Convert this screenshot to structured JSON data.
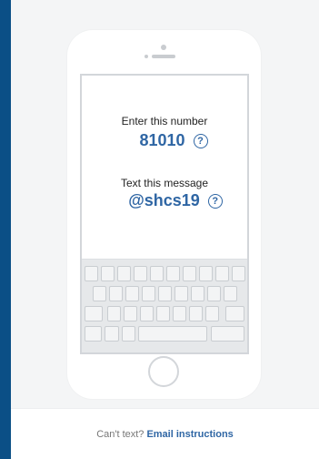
{
  "screen": {
    "number_label": "Enter this number",
    "number_value": "81010",
    "message_label": "Text this message",
    "message_value": "@shcs19",
    "help_glyph": "?"
  },
  "footer": {
    "prompt": "Can't text?",
    "link": "Email instructions"
  },
  "icons": {
    "help": "question-circle-icon",
    "home": "home-button-icon"
  },
  "colors": {
    "accent": "#2f66a4",
    "stripe": "#0b4f86",
    "panel": "#f4f5f6"
  }
}
